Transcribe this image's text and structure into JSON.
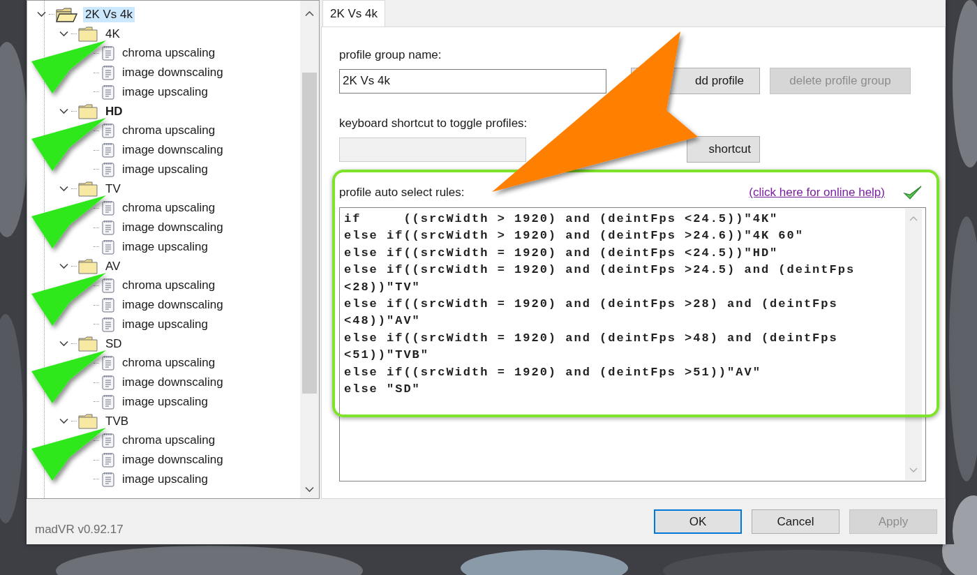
{
  "tree": {
    "items": [
      {
        "label": "2K Vs 4k",
        "kind": "group",
        "selected": true,
        "expanded": true,
        "bold": false,
        "children": [
          {
            "label": "4K",
            "kind": "group",
            "selected": false,
            "expanded": true,
            "bold": false,
            "children": [
              {
                "label": "chroma upscaling",
                "kind": "profile",
                "selected": false
              },
              {
                "label": "image downscaling",
                "kind": "profile",
                "selected": false
              },
              {
                "label": "image upscaling",
                "kind": "profile",
                "selected": false
              }
            ]
          },
          {
            "label": "HD",
            "kind": "group",
            "selected": false,
            "expanded": true,
            "bold": true,
            "children": [
              {
                "label": "chroma upscaling",
                "kind": "profile",
                "selected": false
              },
              {
                "label": "image downscaling",
                "kind": "profile",
                "selected": false
              },
              {
                "label": "image upscaling",
                "kind": "profile",
                "selected": false
              }
            ]
          },
          {
            "label": "TV",
            "kind": "group",
            "selected": false,
            "expanded": true,
            "bold": false,
            "children": [
              {
                "label": "chroma upscaling",
                "kind": "profile",
                "selected": false
              },
              {
                "label": "image downscaling",
                "kind": "profile",
                "selected": false
              },
              {
                "label": "image upscaling",
                "kind": "profile",
                "selected": false
              }
            ]
          },
          {
            "label": "AV",
            "kind": "group",
            "selected": false,
            "expanded": true,
            "bold": false,
            "children": [
              {
                "label": "chroma upscaling",
                "kind": "profile",
                "selected": false
              },
              {
                "label": "image downscaling",
                "kind": "profile",
                "selected": false
              },
              {
                "label": "image upscaling",
                "kind": "profile",
                "selected": false
              }
            ]
          },
          {
            "label": "SD",
            "kind": "group",
            "selected": false,
            "expanded": true,
            "bold": false,
            "children": [
              {
                "label": "chroma upscaling",
                "kind": "profile",
                "selected": false
              },
              {
                "label": "image downscaling",
                "kind": "profile",
                "selected": false
              },
              {
                "label": "image upscaling",
                "kind": "profile",
                "selected": false
              }
            ]
          },
          {
            "label": "TVB",
            "kind": "group",
            "selected": false,
            "expanded": true,
            "bold": false,
            "children": [
              {
                "label": "chroma upscaling",
                "kind": "profile",
                "selected": false
              },
              {
                "label": "image downscaling",
                "kind": "profile",
                "selected": false
              },
              {
                "label": "image upscaling",
                "kind": "profile",
                "selected": false
              }
            ]
          }
        ]
      }
    ]
  },
  "tabs": [
    {
      "label": "2K Vs 4k",
      "selected": true
    }
  ],
  "group_name": {
    "label": "profile group name:",
    "value": "2K Vs 4k"
  },
  "add_profile_button": {
    "label": "dd profile",
    "disabled": false
  },
  "delete_group_button": {
    "label": "delete profile group",
    "disabled": true
  },
  "shortcut": {
    "label": "keyboard shortcut to toggle profiles:",
    "disabled": true
  },
  "shortcut_button": {
    "label": "shortcut",
    "disabled": false
  },
  "rules": {
    "label": "profile auto select rules:",
    "help_link": "(click here for online help)",
    "valid": true,
    "lines": [
      "if     ((srcWidth > 1920) and (deintFps <24.5))\"4K\"",
      "else if((srcWidth > 1920) and (deintFps >24.6))\"4K 60\"",
      "else if((srcWidth = 1920) and (deintFps <24.5))\"HD\"",
      "else if((srcWidth = 1920) and (deintFps >24.5) and (deintFps",
      "<28))\"TV\"",
      "else if((srcWidth = 1920) and (deintFps >28) and (deintFps",
      "<48))\"AV\"",
      "else if((srcWidth = 1920) and (deintFps >48) and (deintFps",
      "<51))\"TVB\"",
      "else if((srcWidth = 1920) and (deintFps >51))\"AV\"",
      "else \"SD\""
    ]
  },
  "version": "madVR v0.92.17",
  "buttons": [
    {
      "label": "OK",
      "default": true,
      "disabled": false
    },
    {
      "label": "Cancel",
      "default": false,
      "disabled": false
    },
    {
      "label": "Apply",
      "default": false,
      "disabled": true
    }
  ]
}
